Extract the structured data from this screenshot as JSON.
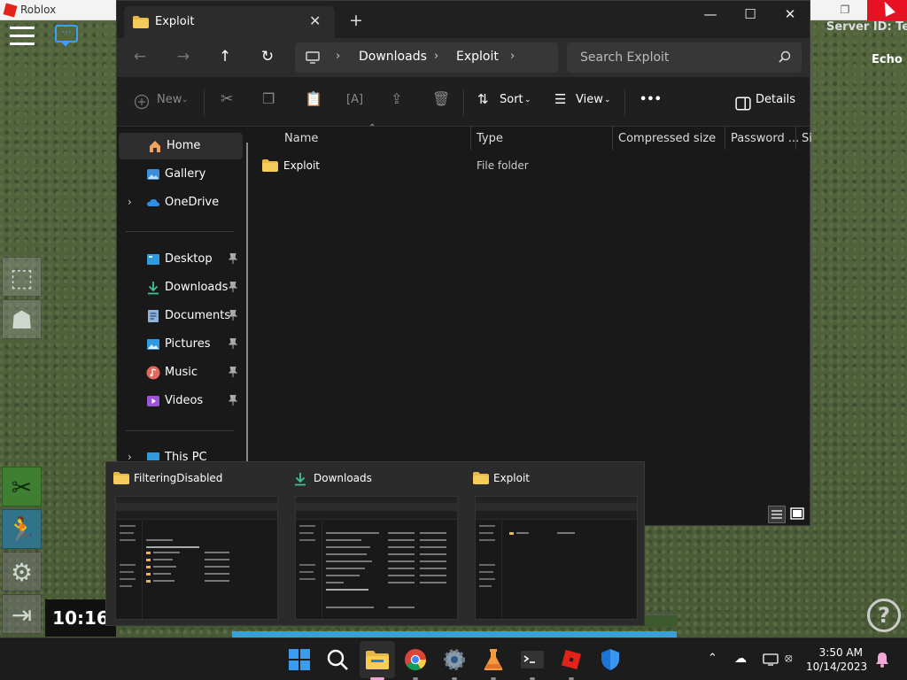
{
  "roblox": {
    "window_title": "Roblox",
    "server_id": "Server ID: Test",
    "echo": "Echo",
    "timer": "10:16",
    "help": "?"
  },
  "explorer": {
    "tab_title": "Exploit",
    "new_tab": "+",
    "address": [
      "Downloads",
      "Exploit"
    ],
    "search_placeholder": "Search Exploit",
    "toolbar": {
      "new": "New",
      "sort": "Sort",
      "view": "View",
      "more": "•••",
      "details": "Details"
    },
    "sidebar": {
      "home": "Home",
      "gallery": "Gallery",
      "onedrive": "OneDrive",
      "desktop": "Desktop",
      "downloads": "Downloads",
      "documents": "Documents",
      "pictures": "Pictures",
      "music": "Music",
      "videos": "Videos",
      "this_pc": "This PC"
    },
    "columns": {
      "name": "Name",
      "type": "Type",
      "compressed": "Compressed size",
      "password": "Password ...",
      "size": "Si"
    },
    "rows": [
      {
        "name": "Exploit",
        "type": "File folder"
      }
    ]
  },
  "thumbnails": [
    {
      "title": "FilteringDisabled"
    },
    {
      "title": "Downloads"
    },
    {
      "title": "Exploit"
    }
  ],
  "taskbar": {
    "time": "3:50 AM",
    "date": "10/14/2023"
  },
  "colors": {
    "folder_yellow": "#e8b847",
    "accent_blue": "#4aa3ff",
    "roblox_red": "#e2231a"
  }
}
